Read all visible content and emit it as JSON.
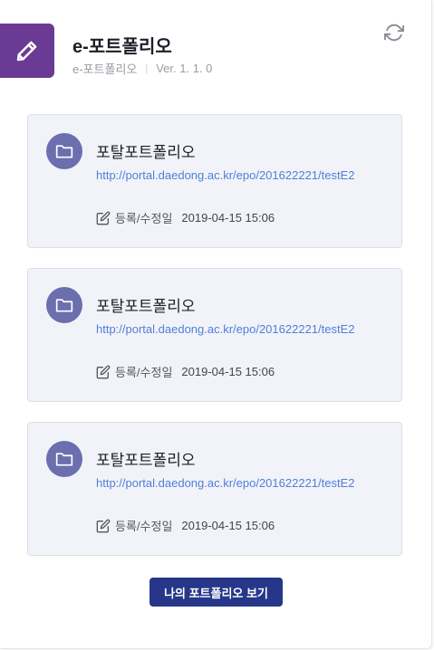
{
  "header": {
    "title": "e-포트폴리오",
    "subtitle": "e-포트폴리오",
    "version": "Ver. 1. 1. 0",
    "app_icon": "pencil-icon",
    "refresh_icon": "refresh-icon",
    "accent": "#6b3a95"
  },
  "cards": [
    {
      "title": "포탈포트폴리오",
      "url": "http://portal.daedong.ac.kr/epo/201622221/testE2",
      "meta_label": "등록/수정일",
      "date": "2019-04-15 15:06"
    },
    {
      "title": "포탈포트폴리오",
      "url": "http://portal.daedong.ac.kr/epo/201622221/testE2",
      "meta_label": "등록/수정일",
      "date": "2019-04-15 15:06"
    },
    {
      "title": "포탈포트폴리오",
      "url": "http://portal.daedong.ac.kr/epo/201622221/testE2",
      "meta_label": "등록/수정일",
      "date": "2019-04-15 15:06"
    }
  ],
  "footer": {
    "button_label": "나의 포트폴리오 보기",
    "button_color": "#26378a"
  }
}
